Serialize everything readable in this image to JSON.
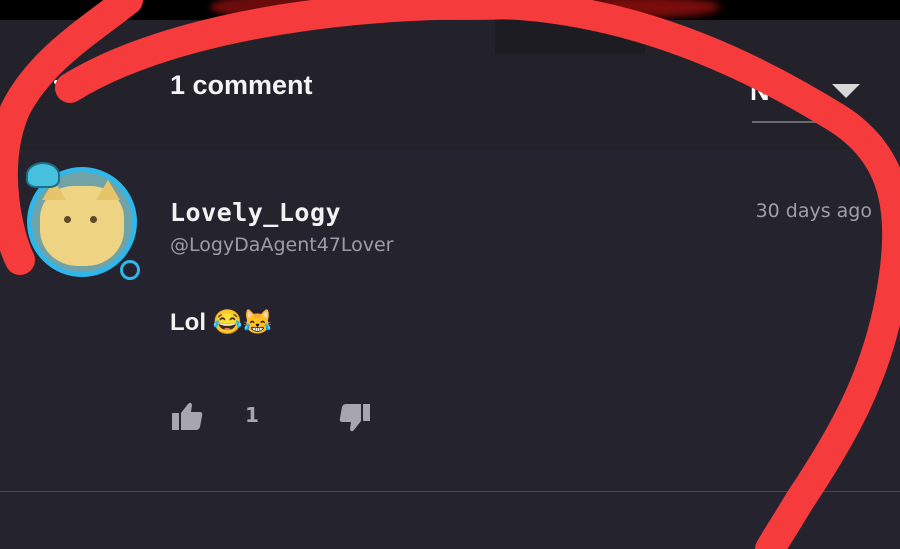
{
  "header": {
    "title": "1 comment",
    "sort_label": "N"
  },
  "comment": {
    "username": "Lovely_Logy",
    "handle": "@LogyDaAgent47Lover",
    "timestamp": "30 days ago",
    "text": "Lol",
    "emojis": "😂😹",
    "like_count": "1"
  },
  "colors": {
    "background": "#25232d",
    "header_background": "#232129",
    "avatar_ring": "#2fb7ea",
    "annotation_red": "#f53b3b"
  },
  "icons": [
    "back-chevron-icon",
    "sort-caret-icon",
    "thumbs-up-icon",
    "thumbs-down-icon",
    "more-vert-icon"
  ]
}
